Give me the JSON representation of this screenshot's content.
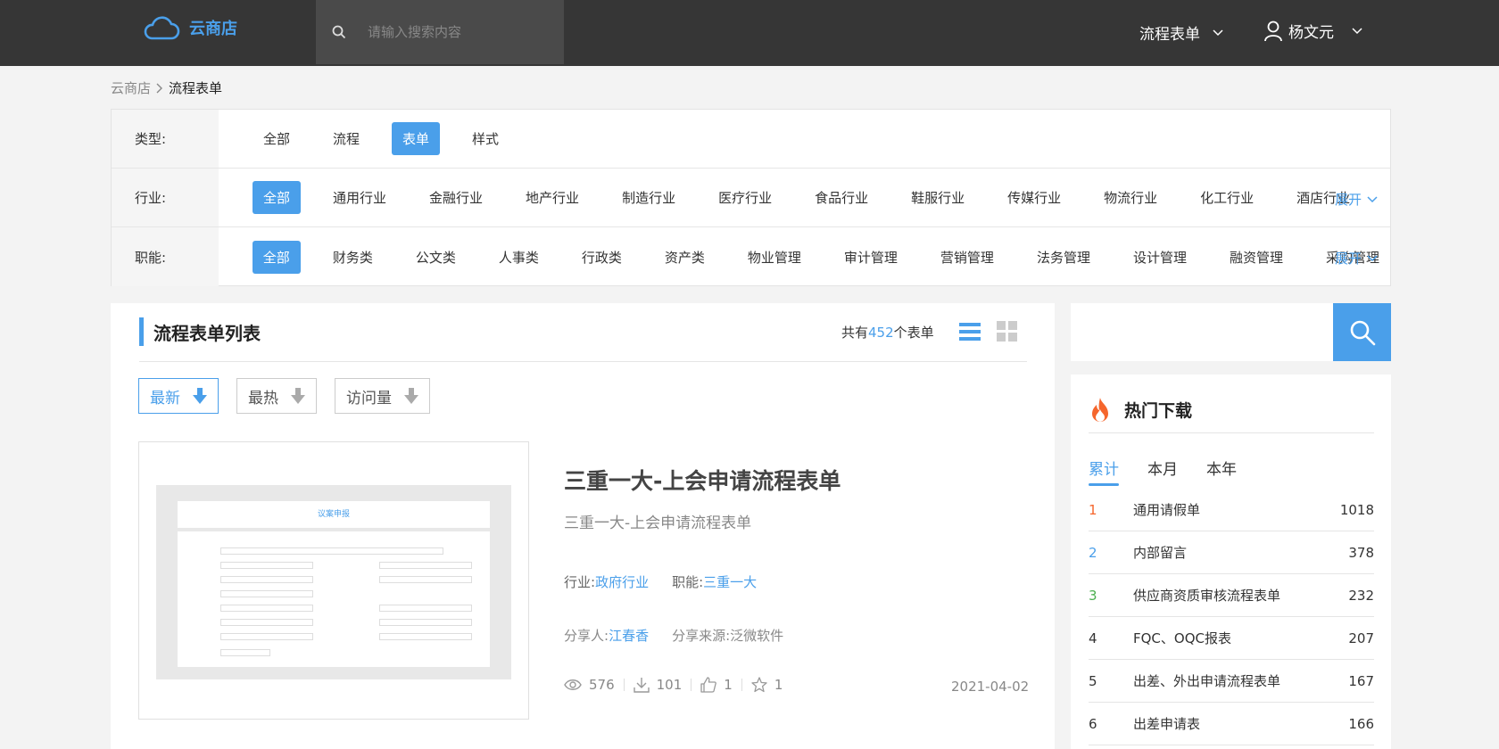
{
  "header": {
    "logo_text": "云商店",
    "search_placeholder": "请输入搜索内容",
    "menu_label": "流程表单",
    "user_name": "杨文元"
  },
  "breadcrumb": {
    "home": "云商店",
    "current": "流程表单"
  },
  "filters": {
    "type": {
      "label": "类型:",
      "items": [
        "全部",
        "流程",
        "表单",
        "样式"
      ],
      "active": 2
    },
    "industry": {
      "label": "行业:",
      "items": [
        "全部",
        "通用行业",
        "金融行业",
        "地产行业",
        "制造行业",
        "医疗行业",
        "食品行业",
        "鞋服行业",
        "传媒行业",
        "物流行业",
        "化工行业",
        "酒店行业"
      ],
      "active": 0,
      "expand": "展开"
    },
    "function": {
      "label": "职能:",
      "items": [
        "全部",
        "财务类",
        "公文类",
        "人事类",
        "行政类",
        "资产类",
        "物业管理",
        "审计管理",
        "营销管理",
        "法务管理",
        "设计管理",
        "融资管理",
        "采购管理"
      ],
      "active": 0,
      "expand": "展开"
    }
  },
  "list": {
    "title": "流程表单列表",
    "total_prefix": "共有",
    "total_count": "452",
    "total_suffix": "个表单",
    "sort": [
      "最新",
      "最热",
      "访问量"
    ],
    "item": {
      "title": "三重一大-上会申请流程表单",
      "subtitle": "三重一大-上会申请流程表单",
      "industry_label": "行业:",
      "industry": "政府行业",
      "function_label": "职能:",
      "function": "三重一大",
      "sharer_label": "分享人:",
      "sharer": "江春香",
      "source_label": "分享来源:",
      "source": "泛微软件",
      "views": "576",
      "downloads": "101",
      "likes": "1",
      "favorites": "1",
      "date": "2021-04-02",
      "thumb_title": "议案申报"
    }
  },
  "hot": {
    "title": "热门下载",
    "tabs": [
      "累计",
      "本月",
      "本年"
    ],
    "active_tab": 0,
    "rank_colors": [
      "#f5662d",
      "#4a9fea",
      "#4caf50"
    ],
    "rows": [
      {
        "rank": "1",
        "name": "通用请假单",
        "count": "1018"
      },
      {
        "rank": "2",
        "name": "内部留言",
        "count": "378"
      },
      {
        "rank": "3",
        "name": "供应商资质审核流程表单",
        "count": "232"
      },
      {
        "rank": "4",
        "name": "FQC、OQC报表",
        "count": "207"
      },
      {
        "rank": "5",
        "name": "出差、外出申请流程表单",
        "count": "167"
      },
      {
        "rank": "6",
        "name": "出差申请表",
        "count": "166"
      }
    ]
  },
  "colors": {
    "accent": "#4a9fea",
    "topbar": "#363636",
    "fire": "#f5662d"
  }
}
